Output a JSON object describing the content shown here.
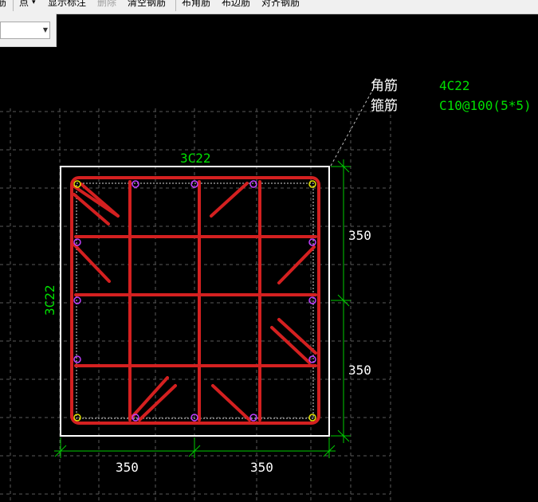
{
  "toolbar": {
    "items": [
      {
        "label": "筋",
        "disabled": false
      },
      {
        "label": "点",
        "disabled": false
      },
      {
        "label": "显示标注",
        "disabled": false
      },
      {
        "label": "删除",
        "disabled": true
      },
      {
        "label": "清空钢筋",
        "disabled": false
      },
      {
        "label": "布角筋",
        "disabled": false
      },
      {
        "label": "布边筋",
        "disabled": false
      },
      {
        "label": "对齐钢筋",
        "disabled": false
      }
    ],
    "dropdown_glyph": "▾"
  },
  "combo": {
    "value": "",
    "arrow_icon": "dropdown-arrow-icon"
  },
  "legend": {
    "corner_label": "角筋",
    "corner_value": "4C22",
    "stirrup_label": "箍筋",
    "stirrup_value": "C10@100(5*5)"
  },
  "section": {
    "top_label": "3C22",
    "left_label": "3C22",
    "dim_right_upper": "350",
    "dim_right_lower": "350",
    "dim_bottom_left": "350",
    "dim_bottom_right": "350"
  },
  "colors": {
    "background": "#000000",
    "grid": "#5a5a5a",
    "outline": "#ffffff",
    "stirrup": "#d42020",
    "dimension": "#00cc00",
    "label_green": "#00e000",
    "label_white": "#ffffff",
    "corner_bar": "#e0e000",
    "side_bar": "#c040ff"
  }
}
